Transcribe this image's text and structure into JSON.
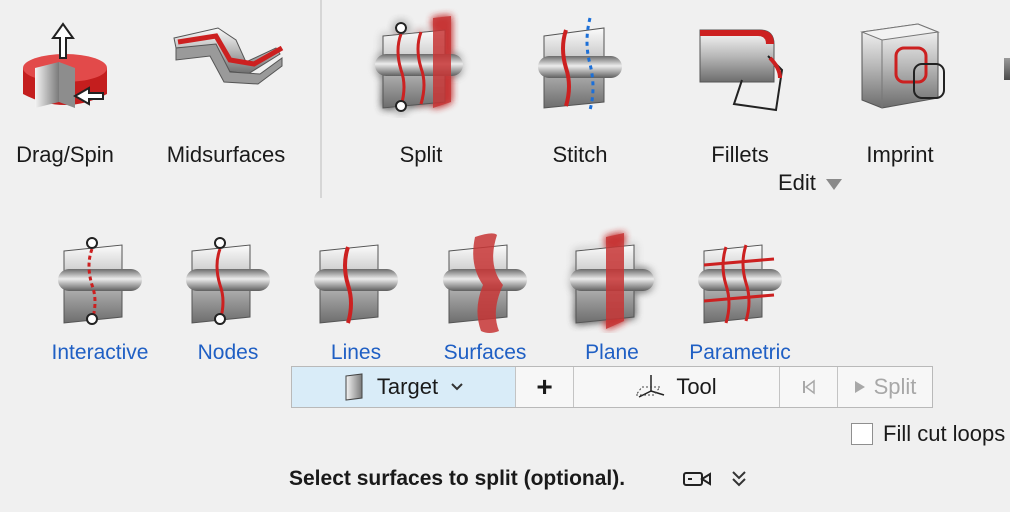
{
  "ribbon": {
    "tools": [
      {
        "label": "Drag/Spin",
        "icon": "drag-spin-icon"
      },
      {
        "label": "Midsurfaces",
        "icon": "midsurfaces-icon"
      },
      {
        "label": "Split",
        "icon": "split-icon",
        "selected": true
      },
      {
        "label": "Stitch",
        "icon": "stitch-icon"
      },
      {
        "label": "Fillets",
        "icon": "fillets-icon"
      },
      {
        "label": "Imprint",
        "icon": "imprint-icon"
      }
    ],
    "group_label": "Edit"
  },
  "modes": [
    {
      "label": "Interactive",
      "icon": "split-interactive-icon"
    },
    {
      "label": "Nodes",
      "icon": "split-nodes-icon"
    },
    {
      "label": "Lines",
      "icon": "split-lines-icon"
    },
    {
      "label": "Surfaces",
      "icon": "split-surfaces-icon"
    },
    {
      "label": "Plane",
      "icon": "split-plane-icon",
      "selected": true
    },
    {
      "label": "Parametric",
      "icon": "split-parametric-icon"
    }
  ],
  "toolbar": {
    "target_label": "Target",
    "add_label": "+",
    "tool_label": "Tool",
    "split_label": "Split"
  },
  "options": {
    "fill_cut_loops_label": "Fill cut loops",
    "fill_cut_loops_checked": false
  },
  "status": {
    "message": "Select surfaces to split (optional)."
  },
  "colors": {
    "accent_red": "#cc2020",
    "selection_glow": "#2ab4f0",
    "link_blue": "#1f5fc4",
    "target_bg": "#d9ecf8"
  }
}
